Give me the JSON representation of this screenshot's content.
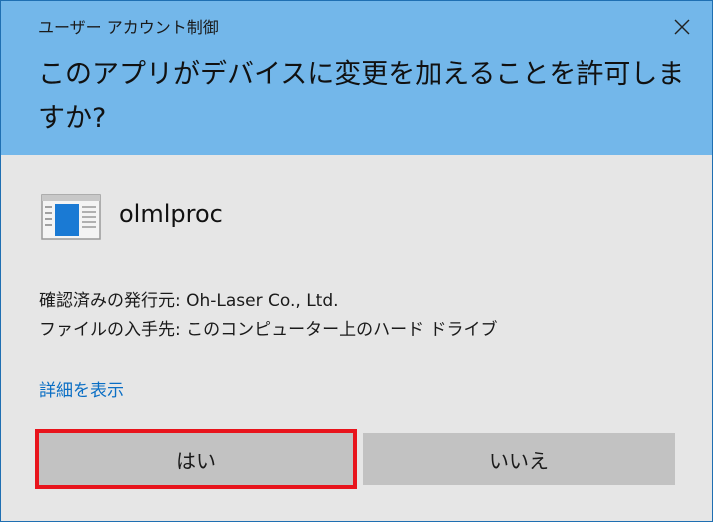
{
  "window": {
    "title": "ユーザー アカウント制御",
    "close_icon": "close-icon"
  },
  "prompt": {
    "question": "このアプリがデバイスに変更を加えることを許可しますか?"
  },
  "app": {
    "icon": "application-window-icon",
    "name": "olmlproc"
  },
  "info": {
    "publisher": "確認済みの発行元: Oh-Laser Co., Ltd.",
    "origin": "ファイルの入手先: このコンピューター上のハード ドライブ"
  },
  "details_link": "詳細を表示",
  "buttons": {
    "yes": "はい",
    "no": "いいえ"
  },
  "colors": {
    "header_bg": "#73b7ea",
    "body_bg": "#e6e6e6",
    "link": "#0a6ec4",
    "button_bg": "#c2c2c2",
    "highlight_border": "#e8141c"
  }
}
